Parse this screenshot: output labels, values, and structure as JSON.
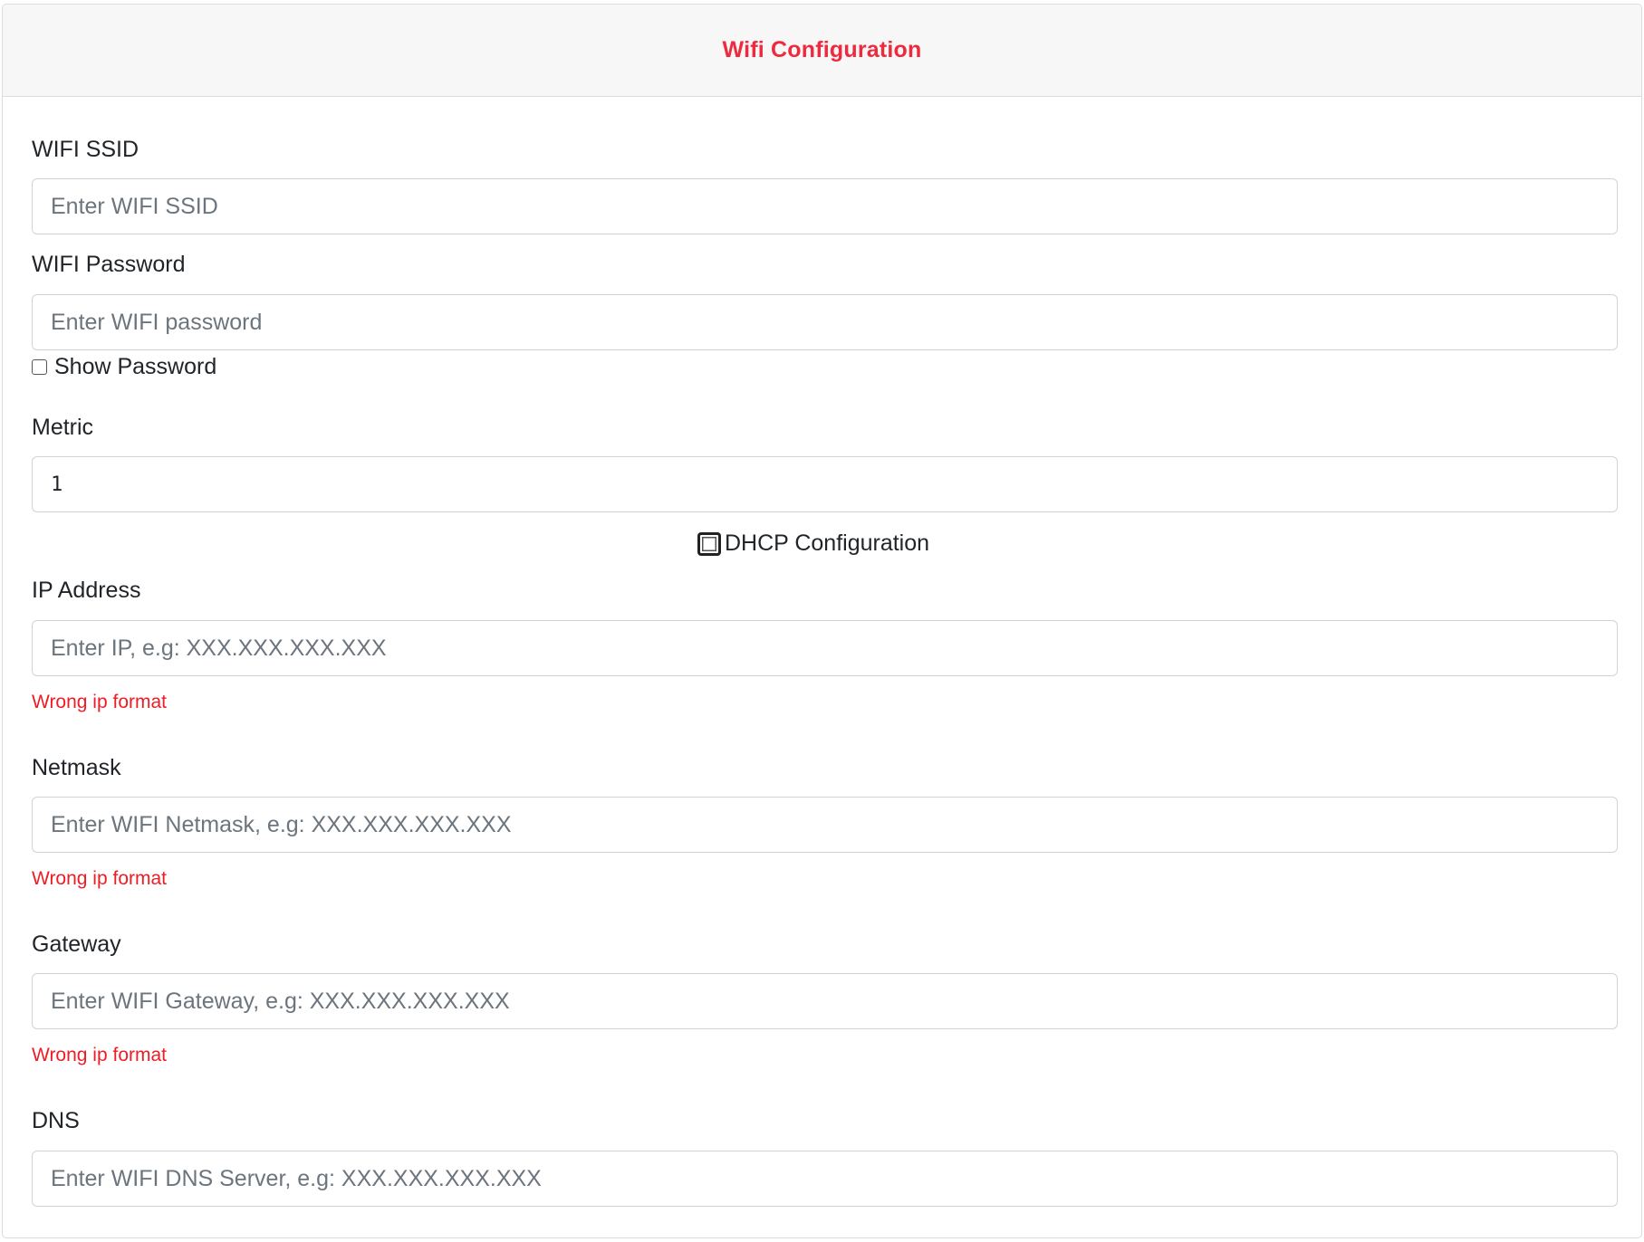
{
  "header": {
    "title": "Wifi Configuration"
  },
  "form": {
    "ssid": {
      "label": "WIFI SSID",
      "placeholder": "Enter WIFI SSID",
      "value": ""
    },
    "password": {
      "label": "WIFI Password",
      "placeholder": "Enter WIFI password",
      "value": ""
    },
    "show_password": {
      "label": "Show Password",
      "checked": false
    },
    "metric": {
      "label": "Metric",
      "value": "1"
    },
    "dhcp": {
      "label": "DHCP Configuration",
      "checked": false
    },
    "ip": {
      "label": "IP Address",
      "placeholder": "Enter IP, e.g: XXX.XXX.XXX.XXX",
      "error": "Wrong ip format"
    },
    "netmask": {
      "label": "Netmask",
      "placeholder": "Enter WIFI Netmask, e.g: XXX.XXX.XXX.XXX",
      "error": "Wrong ip format"
    },
    "gateway": {
      "label": "Gateway",
      "placeholder": "Enter WIFI Gateway, e.g: XXX.XXX.XXX.XXX",
      "error": "Wrong ip format"
    },
    "dns": {
      "label": "DNS",
      "placeholder": "Enter WIFI DNS Server, e.g: XXX.XXX.XXX.XXX"
    }
  },
  "colors": {
    "accent": "#ee2b3e",
    "error": "#ee1c25",
    "header_bg": "#f7f7f7",
    "border": "#ced4da"
  }
}
